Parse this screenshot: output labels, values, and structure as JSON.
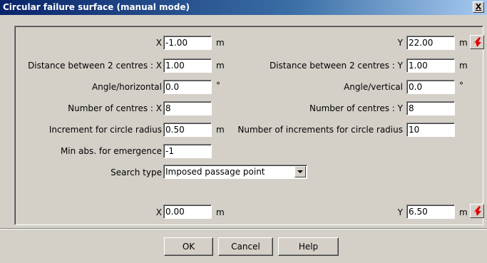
{
  "window": {
    "title": "Circular failure surface (manual mode)",
    "close_label": "X"
  },
  "form": {
    "x_label": "X",
    "x_value": "-1.00",
    "x_unit": "m",
    "y_label": "Y",
    "y_value": "22.00",
    "y_unit": "m",
    "dist_x_label": "Distance between 2 centres : X",
    "dist_x_value": "1.00",
    "dist_x_unit": "m",
    "dist_y_label": "Distance between 2 centres : Y",
    "dist_y_value": "1.00",
    "dist_y_unit": "m",
    "angle_h_label": "Angle/horizontal",
    "angle_h_value": "0.0",
    "angle_h_unit": "°",
    "angle_v_label": "Angle/vertical",
    "angle_v_value": "0.0",
    "angle_v_unit": "°",
    "num_centres_x_label": "Number of centres : X",
    "num_centres_x_value": "8",
    "num_centres_y_label": "Number of centres : Y",
    "num_centres_y_value": "8",
    "increment_radius_label": "Increment for circle radius",
    "increment_radius_value": "0.50",
    "increment_radius_unit": "m",
    "num_increments_label": "Number of increments for circle radius",
    "num_increments_value": "10",
    "min_abs_label": "Min abs. for emergence",
    "min_abs_value": "-1",
    "search_type_label": "Search type",
    "search_type_value": "Imposed passage point",
    "pp_x_label": "X",
    "pp_x_value": "0.00",
    "pp_x_unit": "m",
    "pp_y_label": "Y",
    "pp_y_value": "6.50",
    "pp_y_unit": "m"
  },
  "buttons": {
    "ok": "OK",
    "cancel": "Cancel",
    "help": "Help"
  },
  "icons": {
    "pick_point": "red-arrow-cursor-icon",
    "pick_color": "#e00000"
  }
}
